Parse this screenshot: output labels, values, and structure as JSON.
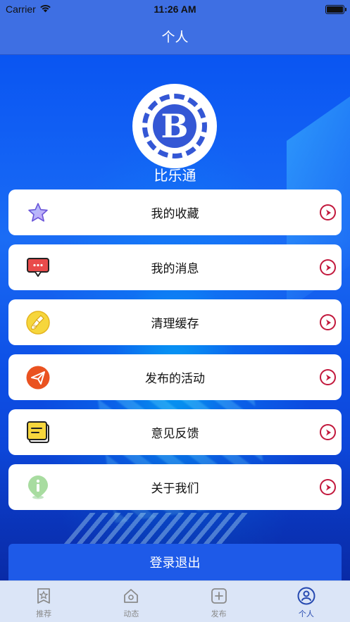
{
  "status_bar": {
    "carrier": "Carrier",
    "time": "11:26 AM"
  },
  "nav": {
    "title": "个人"
  },
  "profile": {
    "name": "比乐通",
    "avatar_letter": "B"
  },
  "menu": [
    {
      "label": "我的收藏",
      "icon": "star-icon"
    },
    {
      "label": "我的消息",
      "icon": "message-icon"
    },
    {
      "label": "清理缓存",
      "icon": "broom-icon"
    },
    {
      "label": "发布的活动",
      "icon": "paper-plane-icon"
    },
    {
      "label": "意见反馈",
      "icon": "feedback-icon"
    },
    {
      "label": "关于我们",
      "icon": "info-icon"
    }
  ],
  "logout": {
    "label": "登录退出"
  },
  "tabs": [
    {
      "label": "推荐",
      "icon": "recommend-icon",
      "active": false
    },
    {
      "label": "动态",
      "icon": "home-icon",
      "active": false
    },
    {
      "label": "发布",
      "icon": "add-icon",
      "active": false
    },
    {
      "label": "个人",
      "icon": "profile-icon",
      "active": true
    }
  ],
  "colors": {
    "nav": "#3e6fe3",
    "accent_arrow": "#c2183c",
    "tab_active": "#2649b0",
    "tab_inactive": "#8a8a8a"
  }
}
